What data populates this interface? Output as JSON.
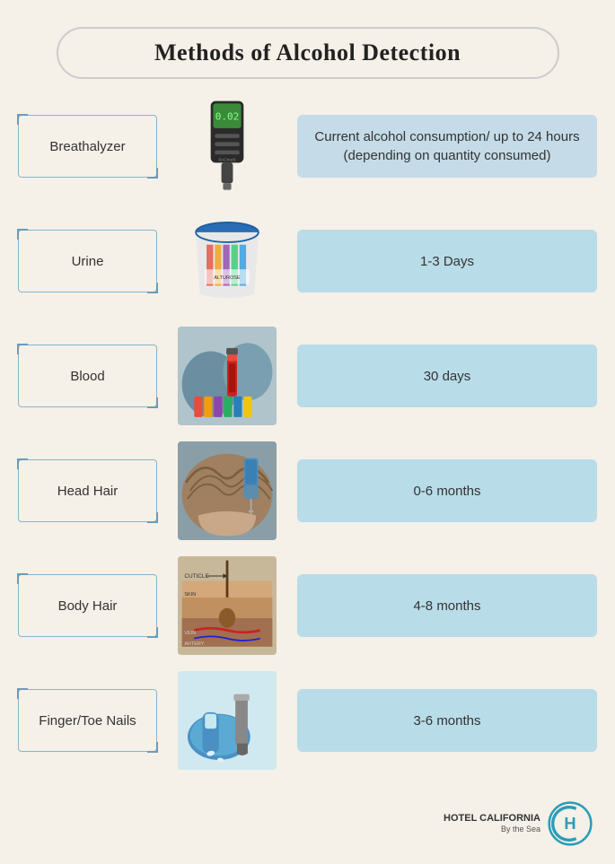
{
  "title": "Methods of Alcohol Detection",
  "methods": [
    {
      "id": "breathalyzer",
      "label": "Breathalyzer",
      "detail": "Current alcohol consumption/ up to 24 hours (depending on quantity consumed)",
      "detailClass": "breathalyzer-detail"
    },
    {
      "id": "urine",
      "label": "Urine",
      "detail": "1-3 Days",
      "detailClass": ""
    },
    {
      "id": "blood",
      "label": "Blood",
      "detail": "30 days",
      "detailClass": ""
    },
    {
      "id": "headhair",
      "label": "Head Hair",
      "detail": "0-6 months",
      "detailClass": ""
    },
    {
      "id": "bodyhair",
      "label": "Body Hair",
      "detail": "4-8 months",
      "detailClass": ""
    },
    {
      "id": "fingernails",
      "label": "Finger/Toe Nails",
      "detail": "3-6 months",
      "detailClass": ""
    }
  ],
  "logo": {
    "main": "HOTEL CALIFORNIA",
    "sub": "By the Sea"
  }
}
